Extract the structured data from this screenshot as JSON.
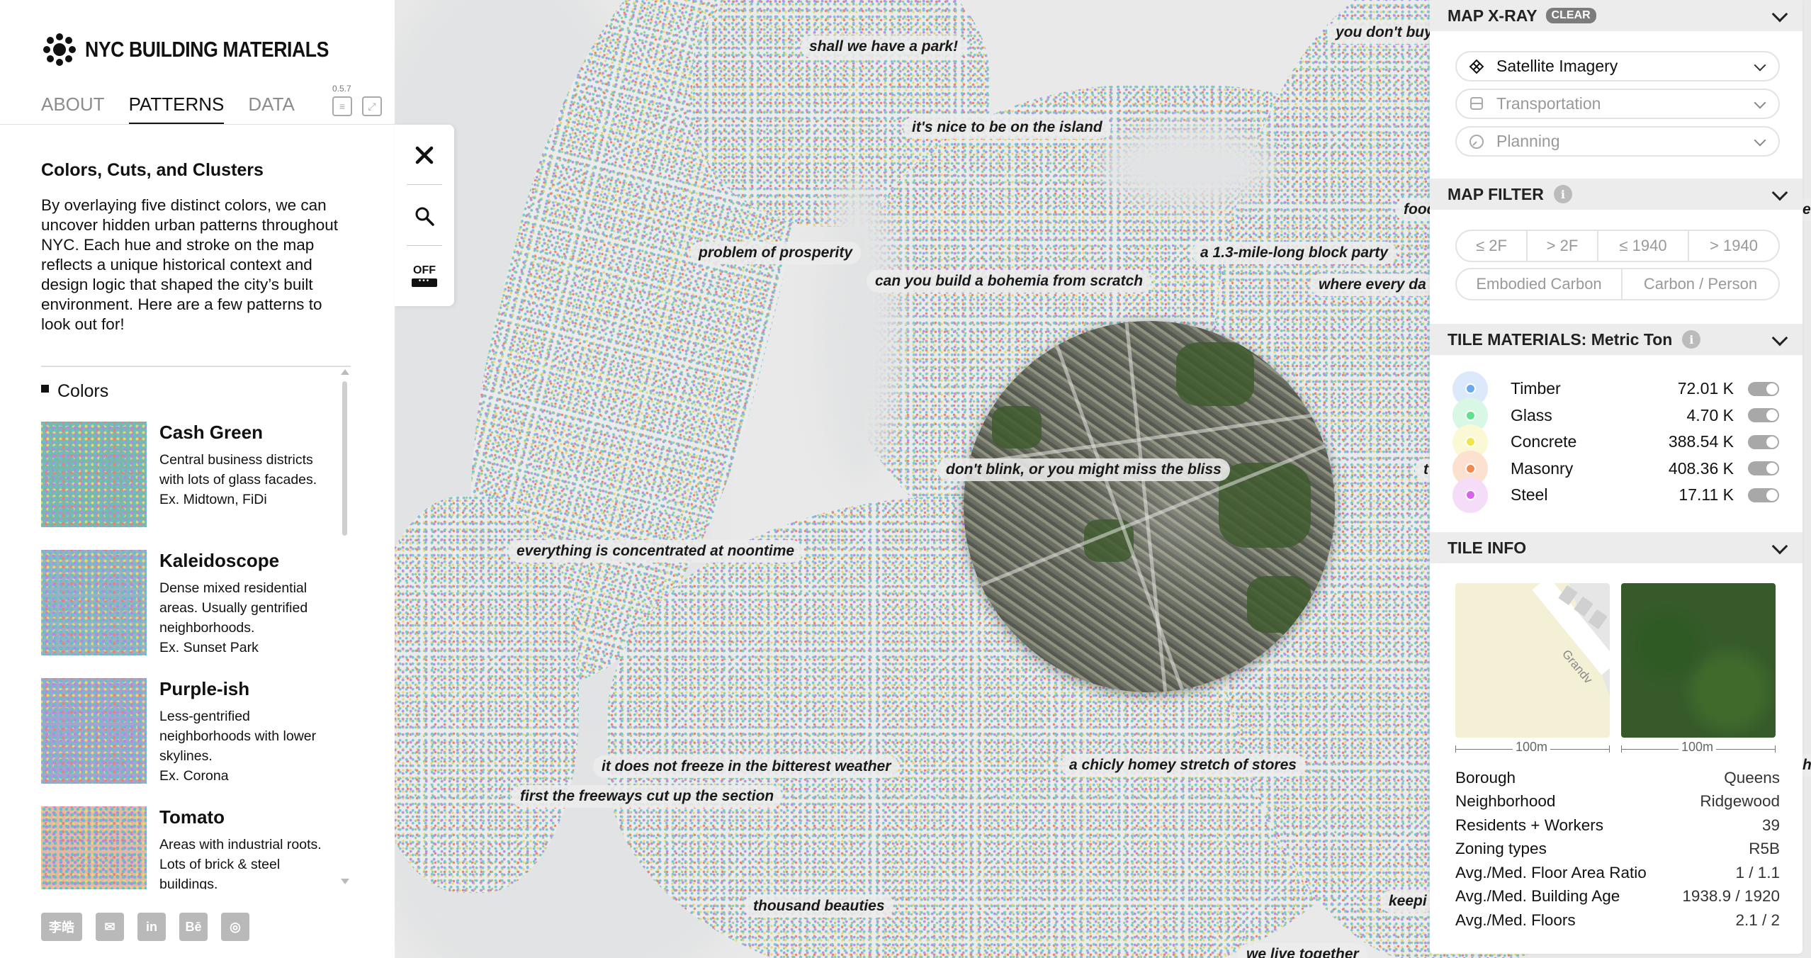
{
  "app": {
    "title": "NYC BUILDING MATERIALS",
    "version": "0.5.7",
    "tabs": [
      {
        "label": "ABOUT",
        "active": false
      },
      {
        "label": "PATTERNS",
        "active": true
      },
      {
        "label": "DATA",
        "active": false
      }
    ]
  },
  "patterns_panel": {
    "title": "Colors, Cuts, and Clusters",
    "body": "By overlaying five distinct colors, we can uncover hidden urban patterns throughout NYC. Each hue and stroke on the map reflects a unique historical context and design logic that shaped the city’s built environment. Here are a few patterns to look out for!",
    "section": "Colors",
    "items": [
      {
        "name": "Cash Green",
        "desc": "Central business districts with lots of glass facades.",
        "example": "Ex. Midtown, FiDi"
      },
      {
        "name": "Kaleidoscope",
        "desc": "Dense mixed residential areas. Usually gentrified neighborhoods.",
        "example": "Ex. Sunset Park"
      },
      {
        "name": "Purple-ish",
        "desc": "Less-gentrified neighborhoods with lower skylines.",
        "example": "Ex. Corona"
      },
      {
        "name": "Tomato",
        "desc": "Areas with industrial roots. Lots of brick & steel buildings.",
        "example": ""
      }
    ]
  },
  "footer": {
    "icons": [
      {
        "name": "cjk-name-icon",
        "glyph": "李皓"
      },
      {
        "name": "mail-icon",
        "glyph": "✉"
      },
      {
        "name": "linkedin-icon",
        "glyph": "in"
      },
      {
        "name": "behance-icon",
        "glyph": "Bē"
      },
      {
        "name": "instagram-icon",
        "glyph": "◎"
      }
    ]
  },
  "toolbar": {
    "off_label": "OFF"
  },
  "map": {
    "labels": [
      "shall we have a park!",
      "it's nice to be on the island",
      "problem of prosperity",
      "can you build a bohemia from scratch",
      "a 1.3-mile-long block party",
      "where every da",
      "you don't buy",
      "food",
      "don't blink, or you might miss the bliss",
      "everything is concentrated at noontime",
      "it does not freeze in the bitterest weather",
      "first the freeways cut up the section",
      "a chicly homey stretch of stores",
      "thousand beauties",
      "keepi",
      "we live together",
      "t",
      "es",
      "he"
    ]
  },
  "right_panel": {
    "xray": {
      "title": "MAP X-RAY",
      "clear_label": "CLEAR",
      "layers": [
        {
          "label": "Satellite Imagery",
          "icon": "satellite-icon",
          "active": true
        },
        {
          "label": "Transportation",
          "icon": "bus-icon",
          "active": false
        },
        {
          "label": "Planning",
          "icon": "compass-icon",
          "active": false
        }
      ]
    },
    "filter": {
      "title": "MAP FILTER",
      "row1": [
        "≤ 2F",
        "> 2F",
        "≤ 1940",
        "> 1940"
      ],
      "row2": [
        "Embodied Carbon",
        "Carbon / Person"
      ]
    },
    "materials": {
      "title": "TILE MATERIALS: Metric Ton",
      "items": [
        {
          "name": "Timber",
          "value": "72.01 K",
          "color": "#6aa8f0",
          "halo": "#dbe9fb"
        },
        {
          "name": "Glass",
          "value": "4.70 K",
          "color": "#5ee08f",
          "halo": "#d9f7e5"
        },
        {
          "name": "Concrete",
          "value": "388.54 K",
          "color": "#f1e54a",
          "halo": "#fbf8d6"
        },
        {
          "name": "Masonry",
          "value": "408.36 K",
          "color": "#f28a4d",
          "halo": "#fde1d0"
        },
        {
          "name": "Steel",
          "value": "17.11 K",
          "color": "#d764e8",
          "halo": "#f5dcf9"
        }
      ]
    },
    "tile_info": {
      "title": "TILE INFO",
      "scale_label": "100m",
      "street_label": "Grandv",
      "rows": [
        {
          "label": "Borough",
          "value": "Queens"
        },
        {
          "label": "Neighborhood",
          "value": "Ridgewood"
        },
        {
          "label": "Residents + Workers",
          "value": "39"
        },
        {
          "label": "Zoning types",
          "value": "R5B"
        },
        {
          "label": "Avg./Med. Floor Area Ratio",
          "value": "1 / 1.1"
        },
        {
          "label": "Avg./Med. Building Age",
          "value": "1938.9 / 1920"
        },
        {
          "label": "Avg./Med. Floors",
          "value": "2.1 / 2"
        }
      ]
    }
  }
}
